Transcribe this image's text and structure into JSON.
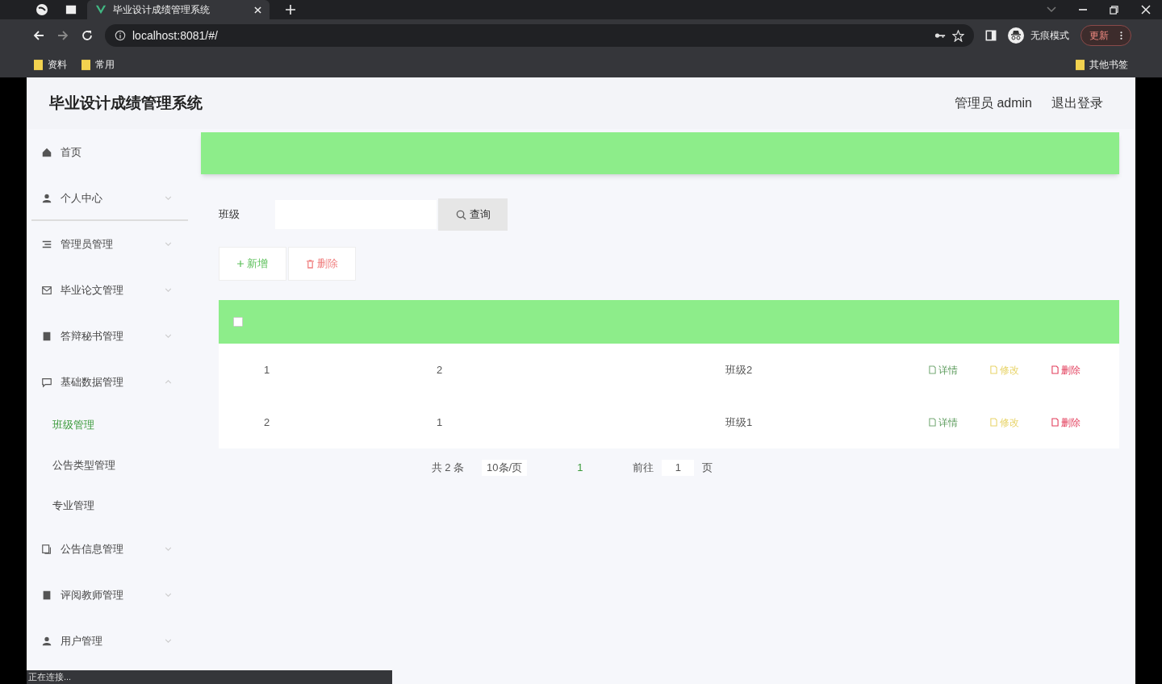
{
  "browser": {
    "tab_title": "毕业设计成绩管理系统",
    "url": "localhost:8081/#/",
    "incognito_label": "无痕模式",
    "update_label": "更新",
    "bookmarks": [
      "资料",
      "常用"
    ],
    "other_bookmarks": "其他书签",
    "status_text": "正在连接..."
  },
  "header": {
    "title": "毕业设计成绩管理系统",
    "user": "管理员 admin",
    "logout": "退出登录"
  },
  "sidebar": {
    "items": [
      {
        "label": "首页"
      },
      {
        "label": "个人中心",
        "expanded": false
      },
      {
        "label": "管理员管理",
        "expanded": false
      },
      {
        "label": "毕业论文管理",
        "expanded": false
      },
      {
        "label": "答辩秘书管理",
        "expanded": false
      },
      {
        "label": "基础数据管理",
        "expanded": true,
        "children": [
          {
            "label": "班级管理",
            "selected": true
          },
          {
            "label": "公告类型管理",
            "selected": false
          },
          {
            "label": "专业管理",
            "selected": false
          }
        ]
      },
      {
        "label": "公告信息管理",
        "expanded": false
      },
      {
        "label": "评阅教师管理",
        "expanded": false
      },
      {
        "label": "用户管理",
        "expanded": false
      }
    ]
  },
  "search": {
    "label": "班级",
    "button": "查询"
  },
  "actions": [
    {
      "label": "新增",
      "kind": "add"
    },
    {
      "label": "删除",
      "kind": "delete"
    }
  ],
  "table": {
    "select_all": {
      "checked": false
    },
    "rows": [
      {
        "cells": [
          "1",
          "2",
          "班级2"
        ],
        "actions": [
          {
            "label": "详情",
            "kind": "detail"
          },
          {
            "label": "修改",
            "kind": "edit"
          },
          {
            "label": "删除",
            "kind": "delete"
          }
        ]
      },
      {
        "cells": [
          "2",
          "1",
          "班级1"
        ],
        "actions": [
          {
            "label": "详情",
            "kind": "detail"
          },
          {
            "label": "修改",
            "kind": "edit"
          },
          {
            "label": "删除",
            "kind": "delete"
          }
        ]
      }
    ]
  },
  "pagination": {
    "total": "共 2 条",
    "page_size": "10条/页",
    "current_page": "1",
    "goto_label": "前往",
    "goto_value": "1",
    "page_unit": "页"
  }
}
